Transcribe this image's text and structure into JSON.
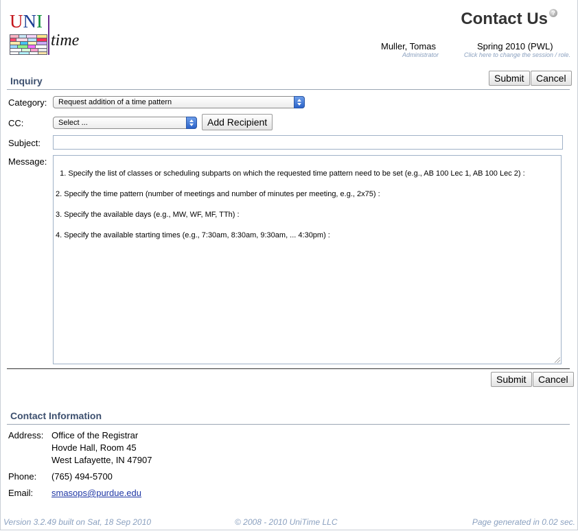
{
  "header": {
    "page_title": "Contact Us",
    "help_icon": "?",
    "user_name": "Muller, Tomas",
    "user_role": "Administrator",
    "session": "Spring 2010 (PWL)",
    "session_hint": "Click here to change the session / role."
  },
  "logo": {
    "uni": "UNI",
    "time": "time"
  },
  "inquiry": {
    "title": "Inquiry",
    "submit_label": "Submit",
    "cancel_label": "Cancel",
    "category_label": "Category:",
    "category_value": "Request addition of a time pattern",
    "cc_label": "CC:",
    "cc_value": "Select ...",
    "add_recipient_label": "Add Recipient",
    "subject_label": "Subject:",
    "subject_value": "",
    "message_label": "Message:",
    "message_value": "1. Specify the list of classes or scheduling subparts on which the requested time pattern need to be set (e.g., AB 100 Lec 1, AB 100 Lec 2) :\n\n2. Specify the time pattern (number of meetings and number of minutes per meeting, e.g., 2x75) :\n\n3. Specify the available days (e.g., MW, WF, MF, TTh) :\n\n4. Specify the available starting times (e.g., 7:30am, 8:30am, 9:30am, ... 4:30pm) :"
  },
  "contact": {
    "title": "Contact Information",
    "address_label": "Address:",
    "address_lines": [
      "Office of the Registrar",
      "Hovde Hall, Room 45",
      "West Lafayette, IN 47907"
    ],
    "phone_label": "Phone:",
    "phone_value": "(765) 494-5700",
    "email_label": "Email:",
    "email_value": "smasops@purdue.edu"
  },
  "footer": {
    "version": "Version 3.2.49 built on Sat, 18 Sep 2010",
    "copyright": "© 2008 - 2010 UniTime LLC",
    "generated": "Page generated in 0.02 sec."
  }
}
